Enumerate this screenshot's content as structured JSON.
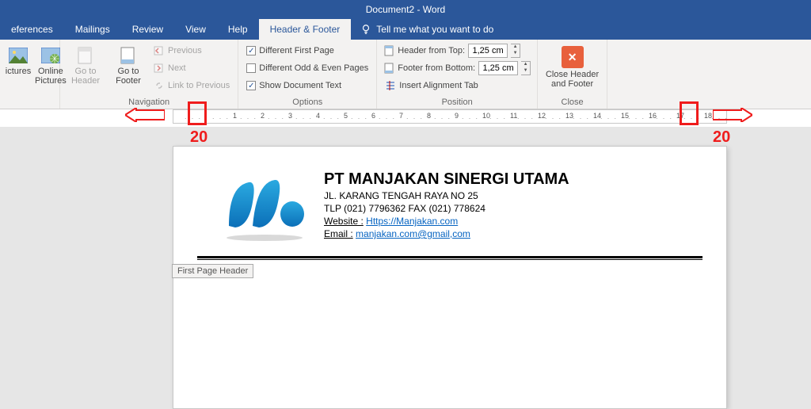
{
  "title": "Document2 - Word",
  "tabs": {
    "references": "eferences",
    "mailings": "Mailings",
    "review": "Review",
    "view": "View",
    "help": "Help",
    "hf": "Header & Footer",
    "tellme": "Tell me what you want to do"
  },
  "ribbon": {
    "insert": {
      "pictures": "ictures",
      "online_pictures": "Online\nPictures"
    },
    "navigation": {
      "goto_header": "Go to\nHeader",
      "goto_footer": "Go to\nFooter",
      "previous": "Previous",
      "next": "Next",
      "link": "Link to Previous",
      "label": "Navigation"
    },
    "options": {
      "diff_first": "Different First Page",
      "diff_oe": "Different Odd & Even Pages",
      "show_doc": "Show Document Text",
      "label": "Options"
    },
    "position": {
      "header_top": "Header from Top:",
      "footer_bottom": "Footer from Bottom:",
      "header_val": "1,25 cm",
      "footer_val": "1,25 cm",
      "align_tab": "Insert Alignment Tab",
      "label": "Position"
    },
    "close": {
      "btn_label": "Close Header\nand Footer",
      "label": "Close"
    }
  },
  "doc": {
    "company": "PT MANJAKAN SINERGI UTAMA",
    "addr": "JL. KARANG TENGAH RAYA NO 25",
    "phone": "TLP (021) 7796362 FAX (021) 778624",
    "web_label": "Website :",
    "web_url": "Https://Manjakan.com",
    "email_label": "Email :",
    "email_val": "manjakan.com@gmail,com",
    "header_tag": "First Page Header"
  },
  "annot": {
    "left": "20",
    "right": "20"
  },
  "option_state": {
    "diff_first": true,
    "diff_oe": false,
    "show_doc": true
  }
}
